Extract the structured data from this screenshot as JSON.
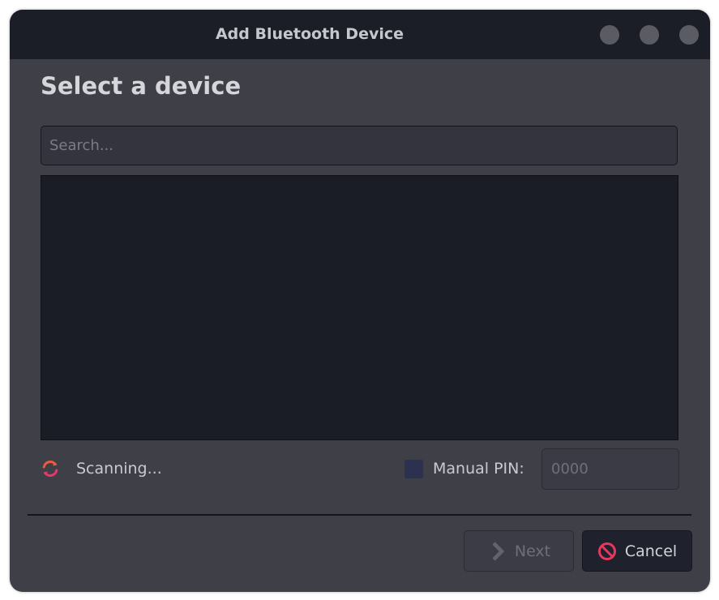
{
  "window": {
    "title": "Add Bluetooth Device",
    "controls": [
      "minimize",
      "maximize",
      "close"
    ]
  },
  "main": {
    "heading": "Select a device",
    "search": {
      "placeholder": "Search...",
      "value": ""
    },
    "devices": []
  },
  "status": {
    "icon": "refresh-icon",
    "text": "Scanning...",
    "icon_colors": [
      "#f05a3c",
      "#e8366f"
    ]
  },
  "pin": {
    "checkbox_checked": false,
    "label": "Manual PIN:",
    "placeholder": "0000",
    "value": ""
  },
  "buttons": {
    "next": {
      "label": "Next",
      "icon": "chevron-right-icon",
      "enabled": false
    },
    "cancel": {
      "label": "Cancel",
      "icon": "cancel-icon",
      "icon_color": "#e8365d"
    }
  }
}
